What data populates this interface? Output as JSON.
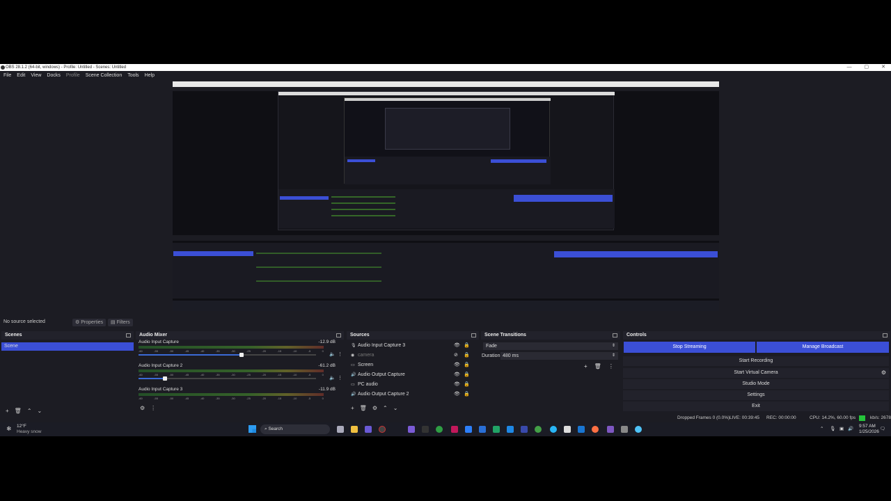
{
  "window": {
    "title": "OBS 28.1.2 (64-bit, windows) - Profile: Untitled - Scenes: Untitled",
    "controls": [
      "—",
      "▢",
      "✕"
    ]
  },
  "menu": [
    "File",
    "Edit",
    "View",
    "Docks",
    "Profile",
    "Scene Collection",
    "Tools",
    "Help"
  ],
  "source_bar": {
    "status": "No source selected",
    "properties": "Properties",
    "filters": "Filters"
  },
  "scenes": {
    "title": "Scenes",
    "items": [
      "Scene"
    ],
    "footer": [
      "+",
      "🗑",
      "⌃",
      "⌄"
    ]
  },
  "audio_mixer": {
    "title": "Audio Mixer",
    "channels": [
      {
        "name": "Audio Input Capture",
        "db": "-12.9 dB",
        "level": 0.58
      },
      {
        "name": "Audio Input Capture 2",
        "db": "-61.2 dB",
        "level": 0.15
      },
      {
        "name": "Audio Input Capture 3",
        "db": "-11.9 dB",
        "level": 0.0
      }
    ],
    "scale": [
      "-60",
      "-55",
      "-50",
      "-45",
      "-40",
      "-35",
      "-30",
      "-25",
      "-20",
      "-15",
      "-10",
      "-5",
      "0"
    ]
  },
  "sources": {
    "title": "Sources",
    "items": [
      {
        "name": "Audio Input Capture 3",
        "icon": "🎙",
        "dim": false
      },
      {
        "name": "camera",
        "icon": "◉",
        "dim": true
      },
      {
        "name": "Screen",
        "icon": "▭",
        "dim": false
      },
      {
        "name": "Audio Output Capture",
        "icon": "🔊",
        "dim": false
      },
      {
        "name": "PC audio",
        "icon": "▭",
        "dim": false
      },
      {
        "name": "Audio Output Capture 2",
        "icon": "🔊",
        "dim": false
      }
    ]
  },
  "scene_transitions": {
    "title": "Scene Transitions",
    "transition": "Fade",
    "duration_label": "Duration",
    "duration_value": "480 ms"
  },
  "controls": {
    "title": "Controls",
    "stop_streaming": "Stop Streaming",
    "manage_broadcast": "Manage Broadcast",
    "start_recording": "Start Recording",
    "start_virtual_camera": "Start Virtual Camera",
    "studio_mode": "Studio Mode",
    "settings": "Settings",
    "exit": "Exit"
  },
  "status": {
    "dropped_frames": "Dropped Frames 0 (0.0%)",
    "live": "LIVE: 00:39:45",
    "rec": "REC: 00:00:00",
    "cpu": "CPU: 14.2%, 60.00 fps",
    "kbps": "kb/s: 2678"
  },
  "taskbar": {
    "weather_temp": "12°F",
    "weather_desc": "Heavy snow",
    "search": "Search",
    "time": "9:57 AM",
    "date": "1/25/2026"
  },
  "colors": {
    "accent": "#3b4fd6",
    "panel": "#1c1c23",
    "live_green": "#25c43a"
  }
}
